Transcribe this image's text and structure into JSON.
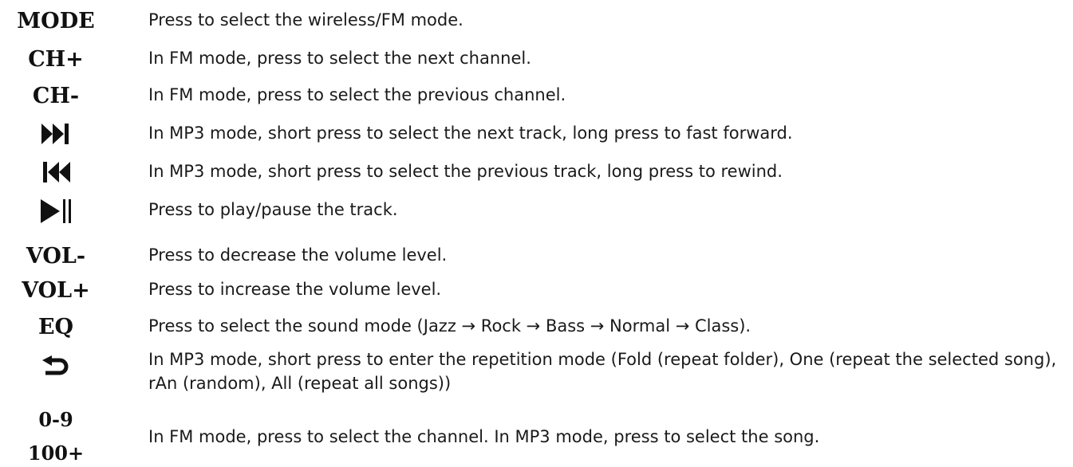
{
  "rows": [
    {
      "key": "MODE",
      "desc": "Press to select the wireless/FM mode."
    },
    {
      "key": "CH+",
      "desc": "In FM mode, press to select the next channel."
    },
    {
      "key": "CH-",
      "desc": "In FM mode, press to select the previous channel."
    },
    {
      "icon": "next-track-icon",
      "desc": "In MP3 mode, short press to select the next track, long press to fast forward."
    },
    {
      "icon": "previous-track-icon",
      "desc": "In MP3 mode, short press to select the previous track, long press to rewind."
    },
    {
      "icon": "play-pause-icon",
      "desc": "Press to play/pause the track."
    },
    {
      "key": "VOL-",
      "desc": "Press to decrease the volume level."
    },
    {
      "key": "VOL+",
      "desc": "Press to increase the volume level."
    },
    {
      "key": "EQ",
      "desc": "Press to select the sound mode (Jazz → Rock → Bass → Normal → Class)."
    },
    {
      "icon": "repeat-icon",
      "desc": "In MP3 mode, short press to enter the repetition mode (Fold (repeat folder), One (repeat the selected song), rAn (random), All (repeat all songs))"
    },
    {
      "key": "0-9",
      "key2": "100+",
      "desc": "In FM mode, press to select the channel. In MP3 mode, press to select the song."
    }
  ]
}
